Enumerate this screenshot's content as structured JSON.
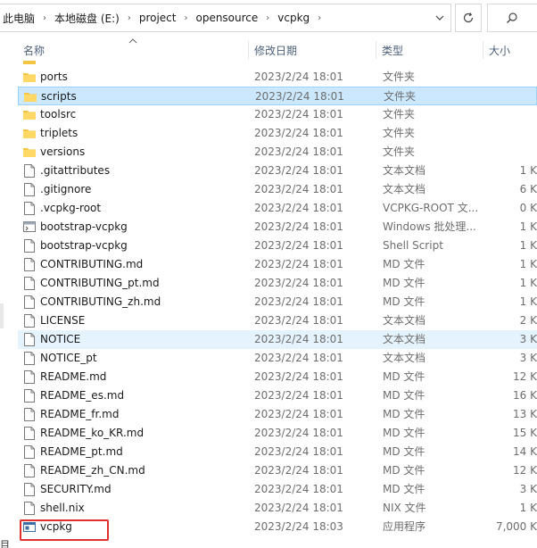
{
  "breadcrumb": [
    "此电脑",
    "本地磁盘 (E:)",
    "project",
    "opensource",
    "vcpkg"
  ],
  "columns": {
    "name": "名称",
    "date": "修改日期",
    "type": "类型",
    "size": "大小"
  },
  "status_left": "目",
  "files": [
    {
      "name": "ports",
      "date": "2023/2/24 18:01",
      "type": "文件夹",
      "size": "",
      "kind": "folder"
    },
    {
      "name": "scripts",
      "date": "2023/2/24 18:01",
      "type": "文件夹",
      "size": "",
      "kind": "folder"
    },
    {
      "name": "toolsrc",
      "date": "2023/2/24 18:01",
      "type": "文件夹",
      "size": "",
      "kind": "folder"
    },
    {
      "name": "triplets",
      "date": "2023/2/24 18:01",
      "type": "文件夹",
      "size": "",
      "kind": "folder"
    },
    {
      "name": "versions",
      "date": "2023/2/24 18:01",
      "type": "文件夹",
      "size": "",
      "kind": "folder"
    },
    {
      "name": ".gitattributes",
      "date": "2023/2/24 18:01",
      "type": "文本文档",
      "size": "1 K",
      "kind": "file"
    },
    {
      "name": ".gitignore",
      "date": "2023/2/24 18:01",
      "type": "文本文档",
      "size": "6 K",
      "kind": "file"
    },
    {
      "name": ".vcpkg-root",
      "date": "2023/2/24 18:01",
      "type": "VCPKG-ROOT 文...",
      "size": "0 K",
      "kind": "file"
    },
    {
      "name": "bootstrap-vcpkg",
      "date": "2023/2/24 18:01",
      "type": "Windows 批处理...",
      "size": "1 K",
      "kind": "bat"
    },
    {
      "name": "bootstrap-vcpkg",
      "date": "2023/2/24 18:01",
      "type": "Shell Script",
      "size": "1 K",
      "kind": "file"
    },
    {
      "name": "CONTRIBUTING.md",
      "date": "2023/2/24 18:01",
      "type": "MD 文件",
      "size": "1 K",
      "kind": "file"
    },
    {
      "name": "CONTRIBUTING_pt.md",
      "date": "2023/2/24 18:01",
      "type": "MD 文件",
      "size": "1 K",
      "kind": "file"
    },
    {
      "name": "CONTRIBUTING_zh.md",
      "date": "2023/2/24 18:01",
      "type": "MD 文件",
      "size": "1 K",
      "kind": "file"
    },
    {
      "name": "LICENSE",
      "date": "2023/2/24 18:01",
      "type": "文本文档",
      "size": "2 K",
      "kind": "file"
    },
    {
      "name": "NOTICE",
      "date": "2023/2/24 18:01",
      "type": "文本文档",
      "size": "3 K",
      "kind": "file"
    },
    {
      "name": "NOTICE_pt",
      "date": "2023/2/24 18:01",
      "type": "文本文档",
      "size": "3 K",
      "kind": "file"
    },
    {
      "name": "README.md",
      "date": "2023/2/24 18:01",
      "type": "MD 文件",
      "size": "12 K",
      "kind": "file"
    },
    {
      "name": "README_es.md",
      "date": "2023/2/24 18:01",
      "type": "MD 文件",
      "size": "16 K",
      "kind": "file"
    },
    {
      "name": "README_fr.md",
      "date": "2023/2/24 18:01",
      "type": "MD 文件",
      "size": "13 K",
      "kind": "file"
    },
    {
      "name": "README_ko_KR.md",
      "date": "2023/2/24 18:01",
      "type": "MD 文件",
      "size": "15 K",
      "kind": "file"
    },
    {
      "name": "README_pt.md",
      "date": "2023/2/24 18:01",
      "type": "MD 文件",
      "size": "14 K",
      "kind": "file"
    },
    {
      "name": "README_zh_CN.md",
      "date": "2023/2/24 18:01",
      "type": "MD 文件",
      "size": "12 K",
      "kind": "file"
    },
    {
      "name": "SECURITY.md",
      "date": "2023/2/24 18:01",
      "type": "MD 文件",
      "size": "3 K",
      "kind": "file"
    },
    {
      "name": "shell.nix",
      "date": "2023/2/24 18:01",
      "type": "NIX 文件",
      "size": "1 K",
      "kind": "file"
    },
    {
      "name": "vcpkg",
      "date": "2023/2/24 18:03",
      "type": "应用程序",
      "size": "7,000 K",
      "kind": "exe"
    }
  ],
  "selected_index": 1,
  "hover_index": 14,
  "highlighted_index": 24,
  "colors": {
    "selection": "#cce8ff",
    "hover": "#e5f3ff",
    "folder": "#f4c542",
    "annotation": "#e03030"
  }
}
